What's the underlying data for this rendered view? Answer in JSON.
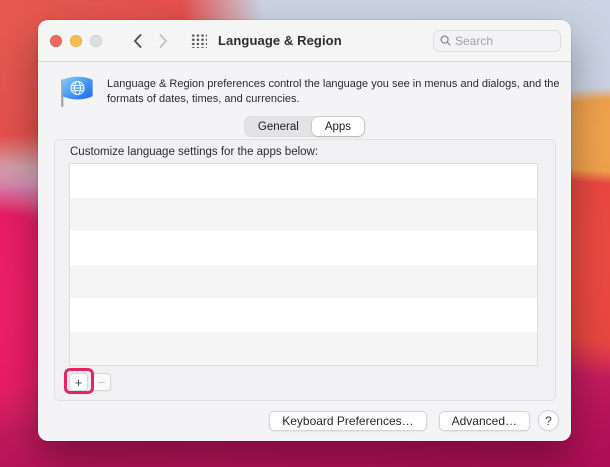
{
  "toolbar": {
    "title": "Language & Region",
    "search_placeholder": "Search"
  },
  "header": {
    "description_lines": [
      "Language & Region preferences control the language you see in menus and dialogs, and the",
      "formats of dates, times, and currencies."
    ]
  },
  "tabs": [
    {
      "label": "General",
      "selected": false
    },
    {
      "label": "Apps",
      "selected": true
    }
  ],
  "apps_panel": {
    "list_label": "Customize language settings for the apps below:",
    "row_count": 6,
    "add_label": "+",
    "remove_label": "−"
  },
  "footer": {
    "keyboard_label": "Keyboard Preferences…",
    "advanced_label": "Advanced…",
    "help_label": "?"
  },
  "colors": {
    "traffic_close": "#ed6a5f",
    "traffic_minimize": "#f5bf4f",
    "traffic_zoom_disabled": "#dedede",
    "highlight_annotation": "#e32560"
  }
}
